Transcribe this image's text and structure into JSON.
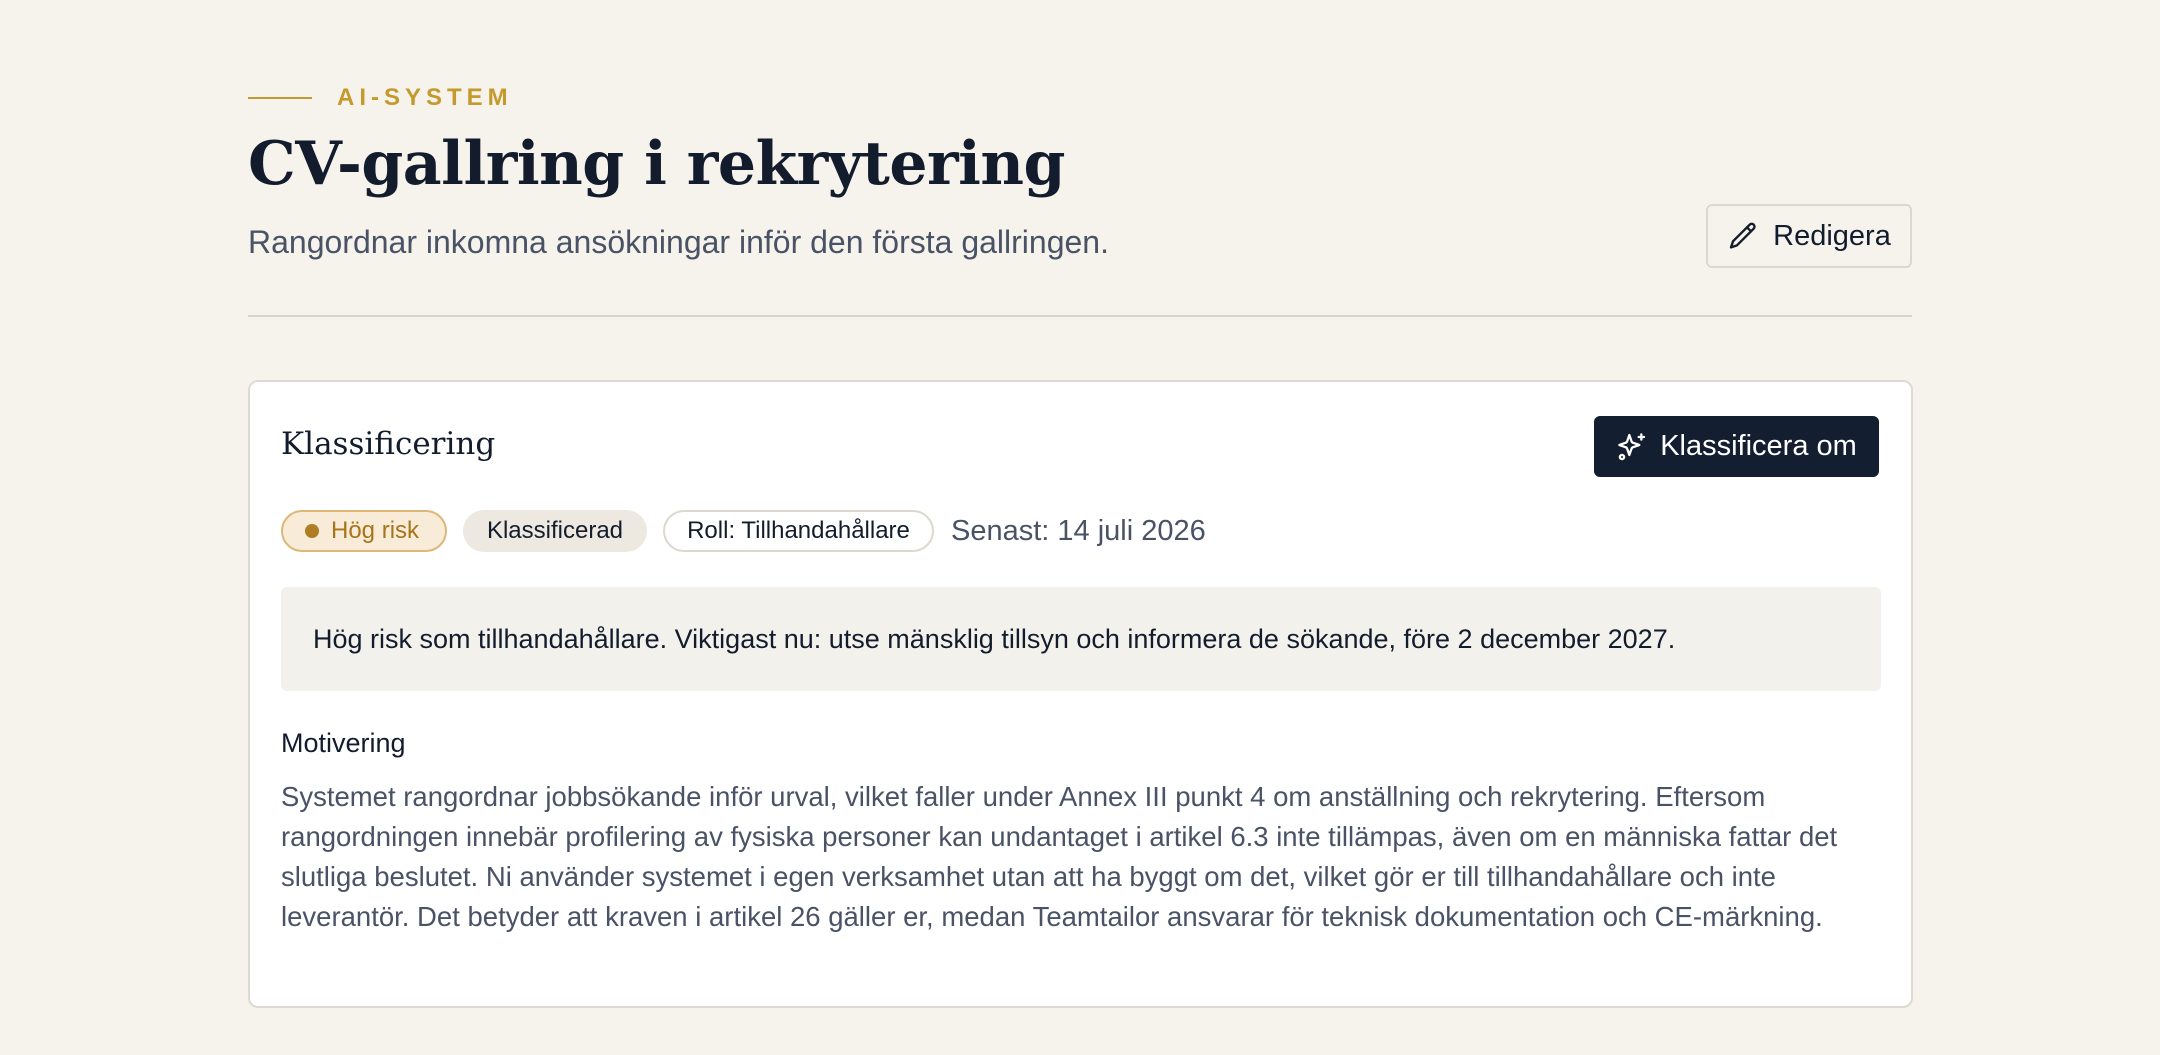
{
  "header": {
    "eyebrow": "AI-SYSTEM",
    "title": "CV-gallring i rekrytering",
    "subtitle": "Rangordnar inkomna ansökningar inför den första gallringen.",
    "edit_label": "Redigera"
  },
  "classification": {
    "title": "Klassificering",
    "reclassify_label": "Klassificera om",
    "risk_badge": "Hög risk",
    "status_badge": "Klassificerad",
    "role_badge": "Roll: Tillhandahållare",
    "last_updated": "Senast: 14 juli 2026",
    "summary": "Hög risk som tillhandahållare. Viktigast nu: utse mänsklig tillsyn och informera de sökande, före 2 december 2027.",
    "motivation_heading": "Motivering",
    "motivation_text": "Systemet rangordnar jobbsökande inför urval, vilket faller under Annex III punkt 4 om anställning och rekrytering. Eftersom rangordningen innebär profilering av fysiska personer kan undantaget i artikel 6.3 inte tillämpas, även om en människa fattar det slutliga beslutet. Ni använder systemet i egen verksamhet utan att ha byggt om det, vilket gör er till tillhandahållare och inte leverantör. Det betyder att kraven i artikel 26 gäller er, medan Teamtailor ansvarar för teknisk dokumentation och CE-märkning."
  },
  "icons": {
    "edit": "pencil-icon",
    "reclassify": "sparkles-icon",
    "risk": "dot-icon"
  },
  "colors": {
    "background": "#f6f3ed",
    "accent_gold": "#c49a2c",
    "primary_dark": "#131e31",
    "risk_text": "#a6741b",
    "risk_bg": "#f8ecd8"
  }
}
